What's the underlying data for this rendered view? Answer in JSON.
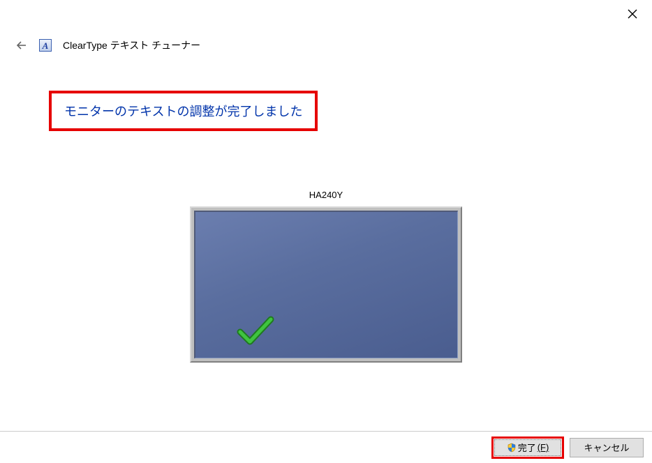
{
  "window": {
    "app_title": "ClearType テキスト チューナー"
  },
  "main": {
    "heading": "モニターのテキストの調整が完了しました",
    "monitor_name": "HA240Y"
  },
  "footer": {
    "finish_label": "完了",
    "finish_accelerator": "(F)",
    "cancel_label": "キャンセル"
  }
}
